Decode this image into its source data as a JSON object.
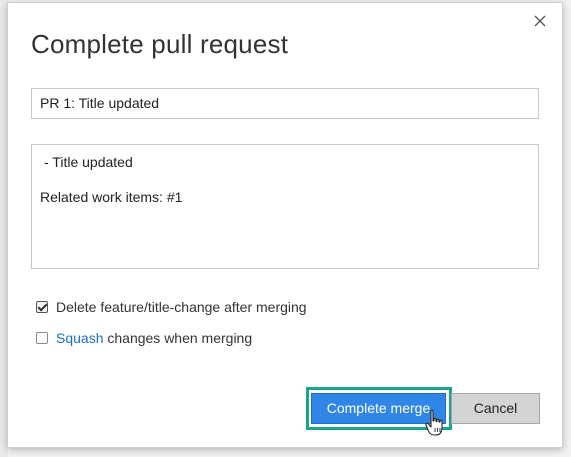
{
  "dialog": {
    "title": "Complete pull request",
    "close_icon": "close-icon",
    "pr_title_value": "PR 1: Title updated",
    "description_line1": "- Title updated",
    "description_line2": "Related work items: #1",
    "options": {
      "delete_branch_label": "Delete feature/title-change after merging",
      "delete_branch_checked": true,
      "squash_link": "Squash",
      "squash_rest": " changes when merging",
      "squash_checked": false
    },
    "buttons": {
      "complete": "Complete merge",
      "cancel": "Cancel"
    }
  },
  "colors": {
    "primary": "#2f86e6",
    "focus_highlight": "#19a58a",
    "link": "#1e6fc3"
  }
}
